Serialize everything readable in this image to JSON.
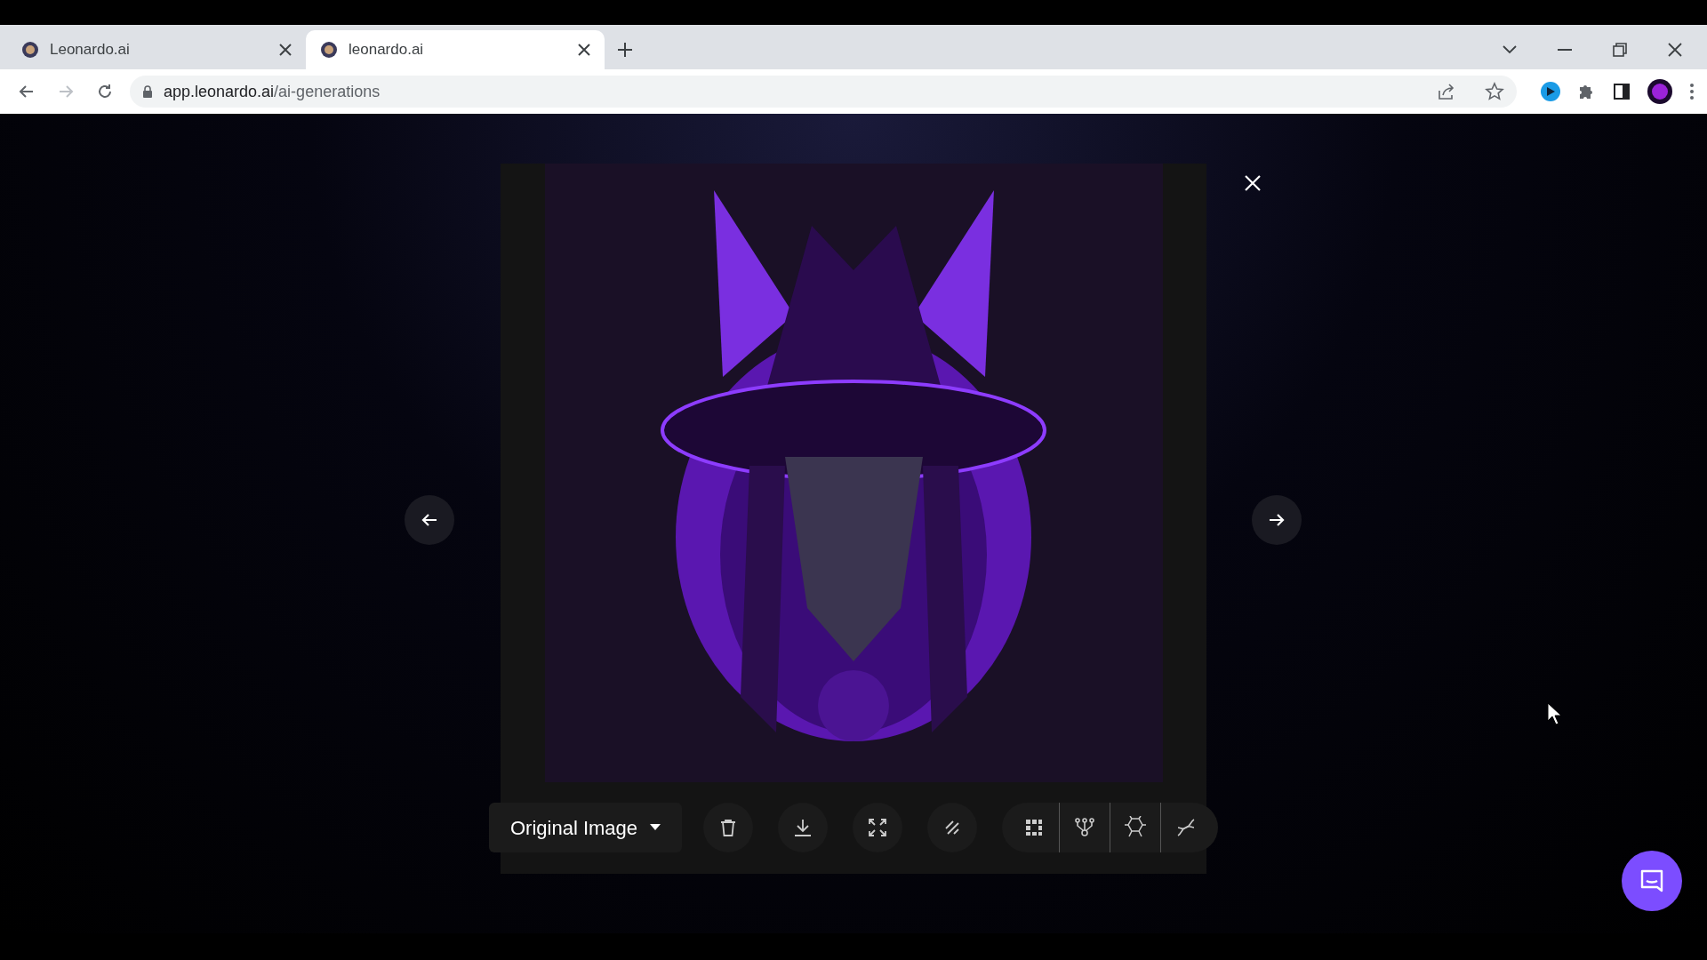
{
  "browser": {
    "tabs": [
      {
        "title": "Leonardo.ai",
        "selected": false
      },
      {
        "title": "leonardo.ai",
        "selected": true
      }
    ],
    "address": {
      "host": "app.leonardo.ai",
      "path": "/ai-generations"
    }
  },
  "viewer": {
    "variant_select": "Original Image"
  }
}
